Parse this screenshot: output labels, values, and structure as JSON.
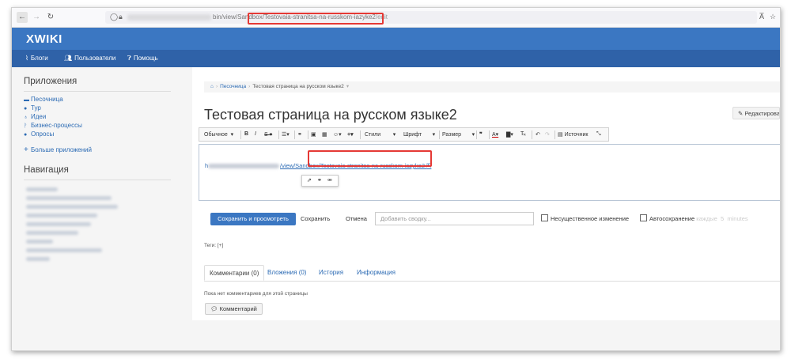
{
  "browser": {
    "url_visible_part": "bin/view/Sandbox/Testovaia-stranitsa-na-russkom-iazyke2",
    "url_suffix": "/edit",
    "reader_icon": "translate-icon",
    "star_icon": "star-icon"
  },
  "app": {
    "logo": "XWIKI"
  },
  "menu": {
    "items": [
      {
        "label": "Блоги",
        "icon": "rss-icon"
      },
      {
        "label": "Пользователи",
        "icon": "users-icon"
      },
      {
        "label": "Помощь",
        "icon": "help-icon"
      }
    ]
  },
  "sidebar": {
    "apps_title": "Приложения",
    "apps": [
      {
        "label": "Песочница",
        "icon": "sandbox-icon"
      },
      {
        "label": "Тур",
        "icon": "info-icon"
      },
      {
        "label": "Идеи",
        "icon": "lightbulb-icon"
      },
      {
        "label": "Бизнес-процессы",
        "icon": "workflow-icon"
      },
      {
        "label": "Опросы",
        "icon": "poll-icon"
      }
    ],
    "more_apps": "Больше приложений",
    "nav_title": "Навигация"
  },
  "breadcrumb": {
    "home_icon": "home-icon",
    "items": [
      "Песочница",
      "Тестовая страница на русском языке2"
    ]
  },
  "page": {
    "title": "Тестовая страница на русском языке2",
    "edit_label": "Редактировать"
  },
  "toolbar": {
    "format": "Обычное",
    "styles": "Стили",
    "font": "Шрифт",
    "size": "Размер",
    "source": "Источник"
  },
  "editor": {
    "link_prefix": "h",
    "link_text": "/view/Sandbox/Testovaia-stranitsa-na-russkom-iazyke2"
  },
  "actions": {
    "save_and_view": "Сохранить и просмотреть",
    "save": "Сохранить",
    "cancel": "Отмена",
    "summary_placeholder": "Добавить сводку...",
    "minor_edit": "Несущественное изменение",
    "autosave": "Автосохранение",
    "autosave_every": "каждые",
    "autosave_value": "5",
    "autosave_unit": "minutes"
  },
  "tags": {
    "label": "Теги: [+]"
  },
  "tabs": [
    {
      "label": "Комментарии (0)"
    },
    {
      "label": "Вложения (0)"
    },
    {
      "label": "История"
    },
    {
      "label": "Информация"
    }
  ],
  "comments": {
    "empty_text": "Пока нет комментариев для этой страницы",
    "add_button": "Комментарий"
  },
  "colors": {
    "header": "#3b77c2",
    "menu": "#2f62a8",
    "link": "#2c6bb4",
    "highlight": "#e53935"
  }
}
